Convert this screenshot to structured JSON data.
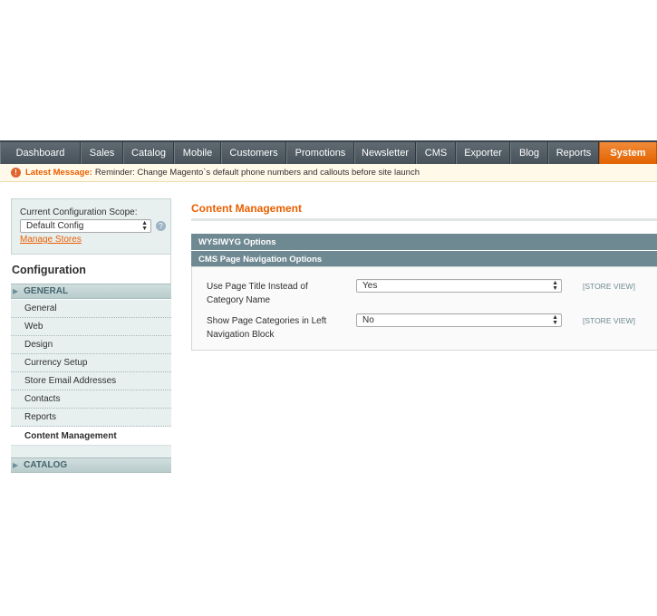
{
  "nav": {
    "items": [
      {
        "label": "Dashboard",
        "w": 89
      },
      {
        "label": "Sales",
        "w": 47
      },
      {
        "label": "Catalog",
        "w": 56
      },
      {
        "label": "Mobile",
        "w": 52
      },
      {
        "label": "Customers",
        "w": 72
      },
      {
        "label": "Promotions",
        "w": 75
      },
      {
        "label": "Newsletter",
        "w": 68
      },
      {
        "label": "CMS",
        "w": 44
      },
      {
        "label": "Exporter",
        "w": 60
      },
      {
        "label": "Blog",
        "w": 42
      },
      {
        "label": "Reports",
        "w": 56
      },
      {
        "label": "System",
        "w": 60
      }
    ],
    "active": "System",
    "accent": "#eb5e00"
  },
  "message": {
    "label": "Latest Message:",
    "text": "Reminder: Change Magento`s default phone numbers and callouts before site launch",
    "icon": "warning-icon"
  },
  "scope": {
    "label": "Current Configuration Scope:",
    "selected": "Default Config",
    "manage_link": "Manage Stores",
    "help_icon": "help-icon"
  },
  "sidebar": {
    "title": "Configuration",
    "general_header": "GENERAL",
    "items": [
      "General",
      "Web",
      "Design",
      "Currency Setup",
      "Store Email Addresses",
      "Contacts",
      "Reports",
      "Content Management"
    ],
    "active_item": "Content Management",
    "catalog_header": "CATALOG"
  },
  "main": {
    "title": "Content Management",
    "fieldset1": "WYSIWYG Options",
    "fieldset2": "CMS Page Navigation Options",
    "rows": [
      {
        "label_line1": "Use Page Title Instead of",
        "label_line2": "Category Name",
        "value": "Yes",
        "scope": "[STORE VIEW]"
      },
      {
        "label_line1": "Show Page Categories in Left",
        "label_line2": "Navigation Block",
        "value": "No",
        "scope": "[STORE VIEW]"
      }
    ]
  }
}
